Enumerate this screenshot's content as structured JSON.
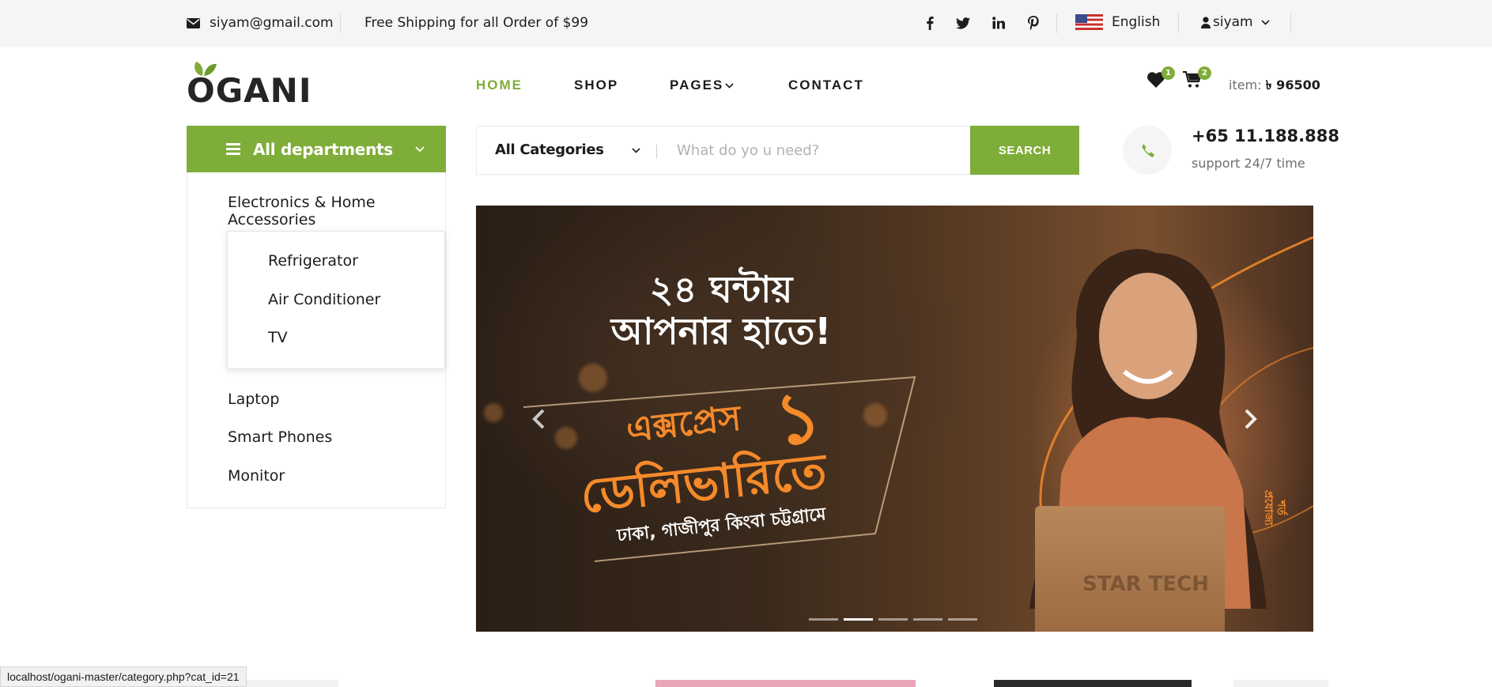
{
  "topbar": {
    "email": "siyam@gmail.com",
    "shipping": "Free Shipping for all Order of $99",
    "language": "English",
    "user": "siyam",
    "social": [
      "facebook-icon",
      "twitter-icon",
      "linkedin-icon",
      "pinterest-icon"
    ]
  },
  "header": {
    "logo": "OGANI",
    "nav": {
      "home": "HOME",
      "shop": "SHOP",
      "pages": "PAGES",
      "contact": "CONTACT"
    },
    "wishlist_count": "1",
    "cart_count": "2",
    "cart_label": "item:",
    "cart_total": "৳ 96500"
  },
  "departments": {
    "title": "All departments",
    "items": [
      "Electronics & Home Accessories",
      "Laptop",
      "Smart Phones",
      "Monitor"
    ],
    "submenu": [
      "Refrigerator",
      "Air Conditioner",
      "TV"
    ]
  },
  "search": {
    "category": "All Categories",
    "placeholder": "What do yo u need?",
    "button": "SEARCH"
  },
  "phone": {
    "number": "+65 11.188.888",
    "support": "support 24/7 time"
  },
  "banner": {
    "line1": "২৪ ঘন্টায়",
    "line2": "আপনার হাতে!",
    "line3": "এক্সপ্রেস",
    "line3_big": "১",
    "line4": "ডেলিভারিতে",
    "line5": "ঢাকা, গাজীপুর কিংবা চট্টগ্রামে",
    "side": "শর্ত প্রযোজ্য",
    "box_logo": "STAR TECH",
    "slide_count": 5,
    "active_slide": 2
  },
  "statusbar": {
    "url": "localhost/ogani-master/category.php?cat_id=21"
  },
  "colors": {
    "accent": "#7fad39",
    "text": "#1c1c1c",
    "muted": "#6f6f6f",
    "topbar_bg": "#f5f5f5"
  }
}
